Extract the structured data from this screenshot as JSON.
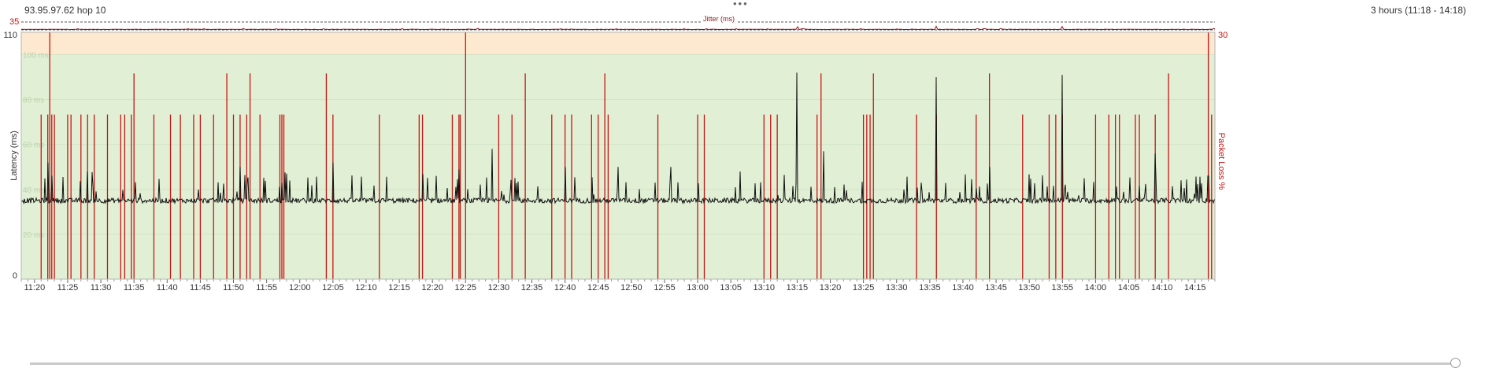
{
  "header": {
    "title": "93.95.97.62 hop 10",
    "range": "3 hours (11:18 - 14:18)"
  },
  "colors": {
    "warn_band": "#fde9cf",
    "good_band": "#e1f0d5",
    "latency_line": "#111111",
    "packet_loss": "#c81414",
    "jitter_line": "#8b1a1a",
    "axis_text": "#333333"
  },
  "chart_data": [
    {
      "type": "line",
      "title": "Jitter (ms)",
      "ylabel": "",
      "ylim": [
        0,
        35
      ],
      "y_max_label": "35",
      "series": [
        {
          "values_description": "low-amplitude jitter with sparse spikes"
        }
      ],
      "spikes": [
        {
          "x": "13:15",
          "y": 14
        },
        {
          "x": "13:36",
          "y": 16
        },
        {
          "x": "13:55",
          "y": 15
        }
      ],
      "baseline_ms": 1.5
    },
    {
      "type": "line",
      "ylabel": "Latency (ms)",
      "y2label": "Packet Loss %",
      "ylim": [
        0,
        110
      ],
      "y2lim": [
        0,
        30
      ],
      "y_top_label": "110",
      "y_zero_label": "0",
      "y2_top_label": "30",
      "gridlines": [
        20,
        40,
        60,
        80,
        100
      ],
      "gridline_labels": [
        "20 ms",
        "40 ms",
        "60 ms",
        "80 ms",
        "100 ms"
      ],
      "bands": [
        {
          "from": 0,
          "to": 100,
          "color": "good"
        },
        {
          "from": 100,
          "to": 110,
          "color": "warn"
        }
      ],
      "x_start": "11:18",
      "x_end": "14:18",
      "x_ticks": [
        "11:20",
        "11:25",
        "11:30",
        "11:35",
        "11:40",
        "11:45",
        "11:50",
        "11:55",
        "12:00",
        "12:05",
        "12:10",
        "12:15",
        "12:20",
        "12:25",
        "12:30",
        "12:35",
        "12:40",
        "12:45",
        "12:50",
        "12:55",
        "13:00",
        "13:05",
        "13:10",
        "13:15",
        "13:20",
        "13:25",
        "13:30",
        "13:35",
        "13:40",
        "13:45",
        "13:50",
        "13:55",
        "14:00",
        "14:05",
        "14:10",
        "14:15"
      ],
      "latency_baseline_ms": 35,
      "latency_spikes": [
        {
          "x": "11:22",
          "y": 52
        },
        {
          "x": "11:28",
          "y": 48
        },
        {
          "x": "11:51",
          "y": 50
        },
        {
          "x": "11:58",
          "y": 47
        },
        {
          "x": "12:05",
          "y": 52
        },
        {
          "x": "12:24",
          "y": 49
        },
        {
          "x": "12:29",
          "y": 58
        },
        {
          "x": "12:40",
          "y": 50
        },
        {
          "x": "12:48",
          "y": 50
        },
        {
          "x": "12:56",
          "y": 50
        },
        {
          "x": "13:15",
          "y": 92
        },
        {
          "x": "13:19",
          "y": 57
        },
        {
          "x": "13:36",
          "y": 90
        },
        {
          "x": "13:44",
          "y": 50
        },
        {
          "x": "13:55",
          "y": 91
        },
        {
          "x": "14:09",
          "y": 56
        },
        {
          "x": "14:17",
          "y": 46
        }
      ],
      "packet_loss_events": [
        {
          "x": "11:21",
          "y": 20
        },
        {
          "x": "11:22",
          "y": 20
        },
        {
          "x": "11:22.3",
          "y": 30
        },
        {
          "x": "11:22.6",
          "y": 20
        },
        {
          "x": "11:23",
          "y": 20
        },
        {
          "x": "11:25",
          "y": 20
        },
        {
          "x": "11:25.5",
          "y": 20
        },
        {
          "x": "11:27",
          "y": 20
        },
        {
          "x": "11:28",
          "y": 20
        },
        {
          "x": "11:29",
          "y": 20
        },
        {
          "x": "11:31",
          "y": 20
        },
        {
          "x": "11:33",
          "y": 20
        },
        {
          "x": "11:33.6",
          "y": 20
        },
        {
          "x": "11:34.6",
          "y": 20
        },
        {
          "x": "11:35",
          "y": 25
        },
        {
          "x": "11:38",
          "y": 20
        },
        {
          "x": "11:40.5",
          "y": 20
        },
        {
          "x": "11:42",
          "y": 20
        },
        {
          "x": "11:44",
          "y": 20
        },
        {
          "x": "11:45",
          "y": 20
        },
        {
          "x": "11:47",
          "y": 20
        },
        {
          "x": "11:49",
          "y": 25
        },
        {
          "x": "11:50",
          "y": 20
        },
        {
          "x": "11:51",
          "y": 20
        },
        {
          "x": "11:52",
          "y": 20
        },
        {
          "x": "11:52.5",
          "y": 25
        },
        {
          "x": "11:54",
          "y": 20
        },
        {
          "x": "11:57",
          "y": 20
        },
        {
          "x": "11:57.3",
          "y": 20
        },
        {
          "x": "11:57.6",
          "y": 20
        },
        {
          "x": "12:04",
          "y": 25
        },
        {
          "x": "12:05",
          "y": 20
        },
        {
          "x": "12:12",
          "y": 20
        },
        {
          "x": "12:18",
          "y": 20
        },
        {
          "x": "12:18.5",
          "y": 20
        },
        {
          "x": "12:23",
          "y": 20
        },
        {
          "x": "12:24",
          "y": 20
        },
        {
          "x": "12:24.2",
          "y": 20
        },
        {
          "x": "12:25",
          "y": 30
        },
        {
          "x": "12:30",
          "y": 20
        },
        {
          "x": "12:32",
          "y": 20
        },
        {
          "x": "12:34",
          "y": 25
        },
        {
          "x": "12:38",
          "y": 20
        },
        {
          "x": "12:40",
          "y": 20
        },
        {
          "x": "12:41",
          "y": 20
        },
        {
          "x": "12:44",
          "y": 20
        },
        {
          "x": "12:45",
          "y": 20
        },
        {
          "x": "12:46",
          "y": 25
        },
        {
          "x": "12:46.5",
          "y": 20
        },
        {
          "x": "12:54",
          "y": 20
        },
        {
          "x": "13:00",
          "y": 20
        },
        {
          "x": "13:01",
          "y": 20
        },
        {
          "x": "13:10",
          "y": 20
        },
        {
          "x": "13:11",
          "y": 20
        },
        {
          "x": "13:12",
          "y": 20
        },
        {
          "x": "13:18",
          "y": 20
        },
        {
          "x": "13:18.6",
          "y": 25
        },
        {
          "x": "13:25",
          "y": 20
        },
        {
          "x": "13:25.5",
          "y": 20
        },
        {
          "x": "13:26",
          "y": 20
        },
        {
          "x": "13:26.5",
          "y": 25
        },
        {
          "x": "13:33",
          "y": 20
        },
        {
          "x": "13:36",
          "y": 20
        },
        {
          "x": "13:42",
          "y": 20
        },
        {
          "x": "13:44",
          "y": 25
        },
        {
          "x": "13:49",
          "y": 20
        },
        {
          "x": "13:53",
          "y": 20
        },
        {
          "x": "13:54",
          "y": 20
        },
        {
          "x": "13:55",
          "y": 20
        },
        {
          "x": "14:00",
          "y": 20
        },
        {
          "x": "14:02",
          "y": 20
        },
        {
          "x": "14:03",
          "y": 20
        },
        {
          "x": "14:03.6",
          "y": 20
        },
        {
          "x": "14:06",
          "y": 20
        },
        {
          "x": "14:06.6",
          "y": 20
        },
        {
          "x": "14:09",
          "y": 20
        },
        {
          "x": "14:11",
          "y": 25
        },
        {
          "x": "14:17",
          "y": 30
        },
        {
          "x": "14:17.5",
          "y": 20
        }
      ]
    }
  ]
}
